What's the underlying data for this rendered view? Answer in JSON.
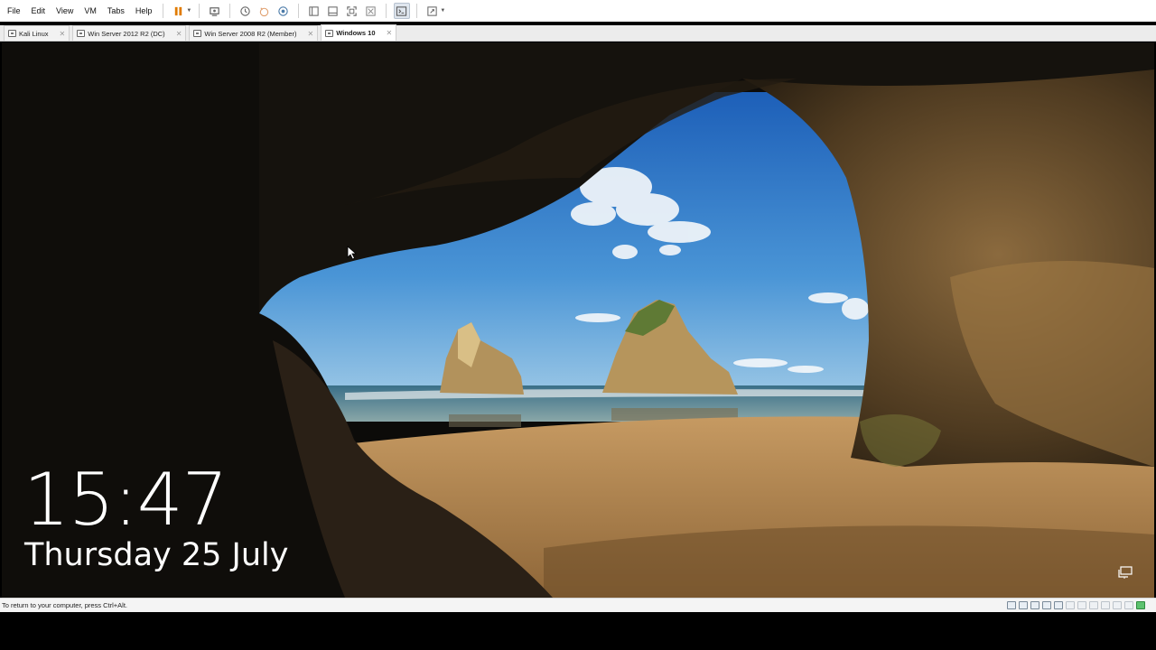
{
  "menu": {
    "items": [
      "File",
      "Edit",
      "View",
      "VM",
      "Tabs",
      "Help"
    ]
  },
  "toolbar": {
    "icons": [
      "pause-icon",
      "send-ctrl-alt-del-icon",
      "snapshot-icon",
      "revert-snapshot-icon",
      "snapshot-manager-icon",
      "show-library-icon",
      "thumbnail-bar-icon",
      "full-screen-icon",
      "unity-icon",
      "console-view-icon",
      "stretch-guest-icon"
    ]
  },
  "tabs": [
    {
      "label": "Kali Linux",
      "active": false
    },
    {
      "label": "Win Server 2012 R2 (DC)",
      "active": false
    },
    {
      "label": "Win Server 2008 R2 (Member)",
      "active": false
    },
    {
      "label": "Windows 10",
      "active": true
    }
  ],
  "lockscreen": {
    "time": "15:47",
    "date": "Thursday 25 July"
  },
  "statusbar": {
    "message": "To return to your computer, press Ctrl+Alt."
  },
  "colors": {
    "accent": "#e07b00",
    "sky": "#2f7fd0",
    "sand": "#b98a55"
  }
}
